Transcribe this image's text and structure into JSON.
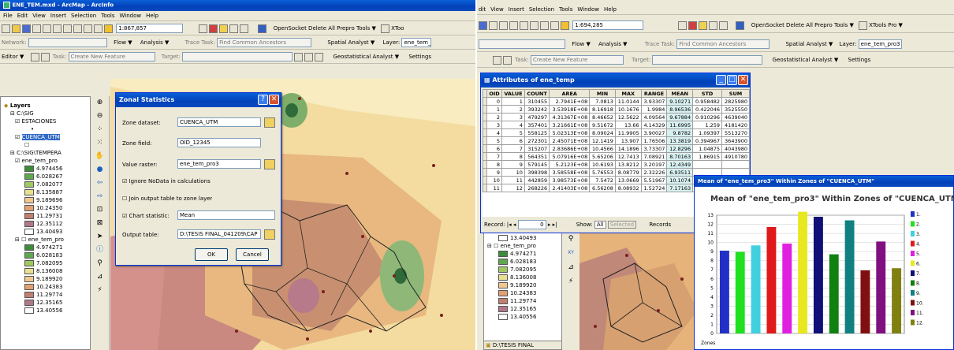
{
  "left": {
    "title": "ENE_TEM.mxd - ArcMap - ArcInfo",
    "menu": [
      "File",
      "Edit",
      "View",
      "Insert",
      "Selection",
      "Tools",
      "Window",
      "Help"
    ],
    "scale": "1:867,857",
    "opensocket": "OpenSocket Delete All Prepro Tools ▼",
    "xtools": "XToo",
    "network": "Network:",
    "flow": "Flow ▼",
    "analysis": "Analysis ▼",
    "trace_task": "Trace Task:",
    "trace_value": "Find Common Ancestors",
    "spatial": "Spatial Analyst ▼",
    "layer_label": "Layer:",
    "layer_value": "ene_tem_p",
    "editor": "Editor ▼",
    "task_label": "Task:",
    "task_value": "Create New Feature",
    "target_label": "Target:",
    "geostat": "Geostatistical Analyst ▼",
    "settings": "Settings"
  },
  "toc": {
    "items": [
      "Layers",
      "C:\\SIG",
      "ESTACIONES",
      "•",
      "CUENCA_UTM",
      "☐",
      "C:\\SIG\\TEMPERA",
      "ene_tem_pro"
    ],
    "legend1": [
      "4.974456",
      "6.028267",
      "7.082077",
      "8.135887",
      "9.189696",
      "10.24350",
      "11.29731",
      "12.35112",
      "13.40493"
    ],
    "group2": "ene_tem_pro",
    "legend2": [
      "4.974271",
      "6.028183",
      "7.082095",
      "8.136008",
      "9.189920",
      "10.24383",
      "11.29774",
      "12.35165",
      "13.40556"
    ]
  },
  "dialog": {
    "title": "Zonal Statistics",
    "zone_dataset_label": "Zone dataset:",
    "zone_dataset": "CUENCA_UTM",
    "zone_field_label": "Zone field:",
    "zone_field": "OID_12345",
    "value_raster_label": "Value raster:",
    "value_raster": "ene_tem_pro3",
    "ignore_nodata": "Ignore NoData in calculations",
    "join_output": "Join output table to zone layer",
    "chart_statistic_label": "Chart statistic:",
    "chart_statistic": "Mean",
    "output_table_label": "Output table:",
    "output_table": "D:\\TESIS FINAL_041209\\CAP",
    "ok": "OK",
    "cancel": "Cancel"
  },
  "right": {
    "menu": [
      "dit",
      "View",
      "Insert",
      "Selection",
      "Tools",
      "Window",
      "Help"
    ],
    "scale": "1:694,285",
    "opensocket": "OpenSocket Delete All Prepro Tools ▼",
    "xtools": "XTools Pro ▼",
    "flow": "Flow ▼",
    "analysis": "Analysis ▼",
    "trace_task": "Trace Task:",
    "trace_value": "Find Common Ancestors",
    "spatial": "Spatial Analyst ▼",
    "layer_label": "Layer:",
    "layer_value": "ene_tem_pro3",
    "task_label": "Task:",
    "task_value": "Create New Feature",
    "target_label": "Target:",
    "geostat": "Geostatistical Analyst ▼",
    "settings": "Settings"
  },
  "attributes": {
    "title": "Attributes of ene_temp",
    "columns": [
      "OID",
      "VALUE",
      "COUNT",
      "AREA",
      "MIN",
      "MAX",
      "RANGE",
      "MEAN",
      "STD",
      "SUM"
    ],
    "rows": [
      [
        "0",
        "1",
        "310455",
        "2.7941E+08",
        "7.0813",
        "11.0144",
        "3.93307",
        "9.10271",
        "0.958482",
        "2825980"
      ],
      [
        "1",
        "2",
        "393242",
        "3.53918E+08",
        "8.16918",
        "10.1676",
        "1.9984",
        "8.96536",
        "0.422046",
        "3525550"
      ],
      [
        "2",
        "3",
        "479297",
        "4.31367E+08",
        "8.46652",
        "12.5622",
        "4.09564",
        "9.67884",
        "0.910296",
        "4639040"
      ],
      [
        "3",
        "4",
        "357401",
        "3.21661E+08",
        "9.51672",
        "13.66",
        "4.14329",
        "11.6995",
        "1.259",
        "4181420"
      ],
      [
        "4",
        "5",
        "558125",
        "5.02313E+08",
        "8.09024",
        "11.9905",
        "3.90027",
        "9.8782",
        "1.09397",
        "5513270"
      ],
      [
        "5",
        "6",
        "272301",
        "2.45071E+08",
        "12.1419",
        "13.907",
        "1.76506",
        "13.3819",
        "0.394967",
        "3643900"
      ],
      [
        "6",
        "7",
        "315207",
        "2.83686E+08",
        "10.4566",
        "14.1896",
        "3.73307",
        "12.8296",
        "1.04875",
        "4043980"
      ],
      [
        "7",
        "8",
        "564351",
        "5.07916E+08",
        "5.65206",
        "12.7413",
        "7.08921",
        "8.70163",
        "1.86915",
        "4910780"
      ],
      [
        "8",
        "9",
        "579145",
        "5.2123E+08",
        "10.6193",
        "13.8212",
        "3.20197",
        "12.4349",
        "",
        "",
        ""
      ],
      [
        "9",
        "10",
        "398398",
        "3.58558E+08",
        "5.76553",
        "8.08779",
        "2.32226",
        "6.93511",
        "",
        "",
        ""
      ],
      [
        "10",
        "11",
        "442859",
        "3.98573E+08",
        "7.5472",
        "13.0669",
        "5.51967",
        "10.1074",
        "",
        "",
        ""
      ],
      [
        "11",
        "12",
        "268226",
        "2.41403E+08",
        "6.56208",
        "8.08932",
        "1.52724",
        "7.17163",
        "",
        "",
        ""
      ]
    ],
    "record_label": "Record:",
    "record_value": "0",
    "show_label": "Show:",
    "show_all": "All",
    "show_selected": "Selected",
    "records": "Records"
  },
  "right_toc": {
    "items": [
      "13.40493",
      "ene_tem_pro"
    ],
    "legend": [
      "4.974271",
      "6.028183",
      "7.082095",
      "8.136008",
      "9.189920",
      "10.24383",
      "11.29774",
      "12.35165",
      "13.40556"
    ],
    "task": "D:\\TESIS FINAL"
  },
  "chart_window": {
    "title": "Mean of \"ene_tem_pro3\" Within Zones of \"CUENCA_UTM\""
  },
  "chart_data": {
    "type": "bar",
    "title": "Mean of \"ene_tem_pro3\" Within Zones of \"CUENCA_UTM\"",
    "xlabel": "Zones",
    "ylabel": "",
    "categories": [
      "1.",
      "2.",
      "3.",
      "4.",
      "5.",
      "6.",
      "7.",
      "8.",
      "9.",
      "10.",
      "11.",
      "12."
    ],
    "values": [
      9.10271,
      8.96536,
      9.67884,
      11.6995,
      9.8782,
      13.3819,
      12.8296,
      8.70163,
      12.4349,
      6.93511,
      10.1074,
      7.17163
    ],
    "colors": [
      "#2330c8",
      "#20e020",
      "#40d0e0",
      "#e01a1a",
      "#e020e0",
      "#e8e820",
      "#101078",
      "#108010",
      "#108080",
      "#801010",
      "#801080",
      "#808010"
    ],
    "ylim": [
      0,
      13
    ],
    "yticks": [
      0,
      1,
      2,
      3,
      4,
      5,
      6,
      7,
      8,
      9,
      10,
      11,
      12,
      13
    ],
    "legend": "right"
  },
  "colors": {
    "dialog_blue": "#0a4bc0",
    "selected": "#316ac5"
  }
}
